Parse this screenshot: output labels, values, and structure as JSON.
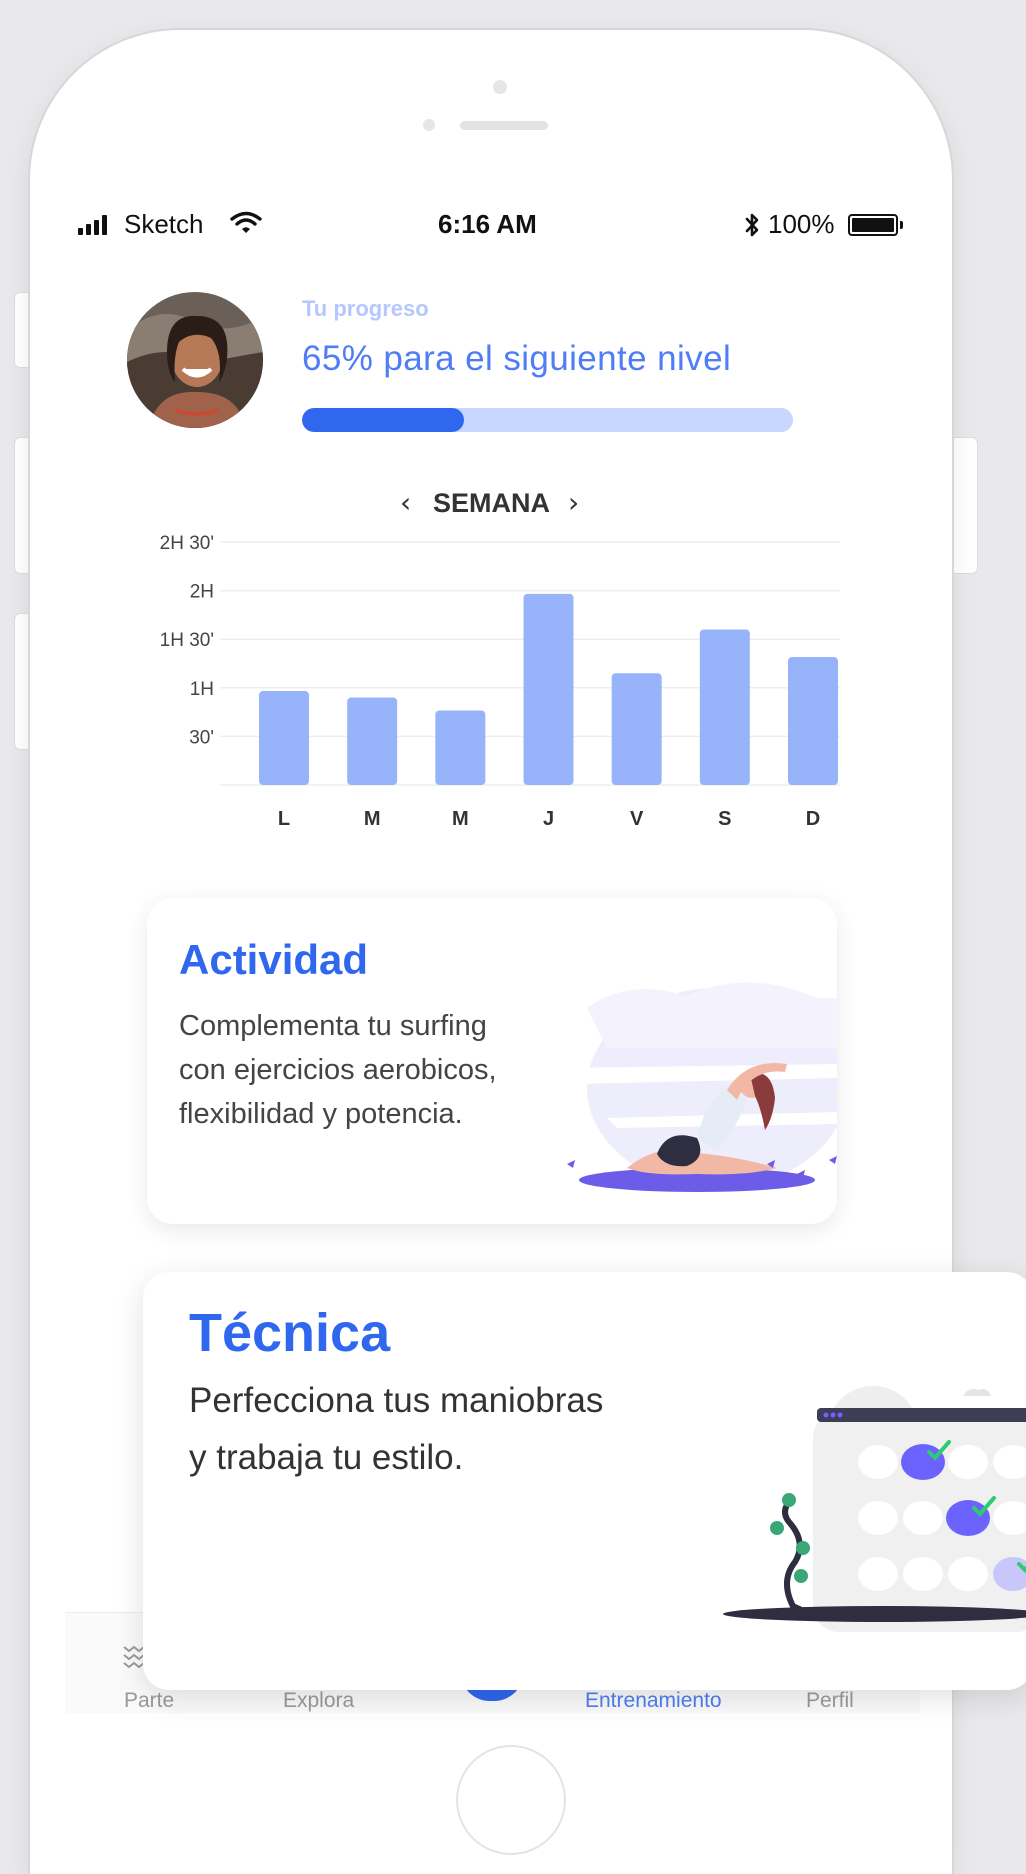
{
  "status_bar": {
    "carrier": "Sketch",
    "time": "6:16 AM",
    "battery_percent": "100%"
  },
  "progress": {
    "label": "Tu progreso",
    "title": "65% para el siguiente nivel",
    "fill_fraction": 0.33
  },
  "week_nav": {
    "prev": "‹",
    "label": "SEMANA",
    "next": "›"
  },
  "chart_data": {
    "type": "bar",
    "categories": [
      "L",
      "M",
      "M",
      "J",
      "V",
      "S",
      "D"
    ],
    "values": [
      58,
      54,
      46,
      118,
      69,
      96,
      79
    ],
    "y_ticks": [
      {
        "value": 150,
        "label": "2H 30'"
      },
      {
        "value": 120,
        "label": "2H"
      },
      {
        "value": 90,
        "label": "1H 30'"
      },
      {
        "value": 60,
        "label": "1H"
      },
      {
        "value": 30,
        "label": "30'"
      }
    ],
    "ylim": [
      0,
      150
    ],
    "grid": true,
    "colors": {
      "bar": "#97b4fb",
      "grid": "#eeeeee",
      "tick": "#444444"
    }
  },
  "cards": {
    "actividad": {
      "title": "Actividad",
      "description": "Complementa tu surfing con ejercicios aerobicos, flexibilidad y potencia."
    },
    "tecnica": {
      "title": "Técnica",
      "description": "Perfecciona tus maniobras y trabaja tu estilo."
    }
  },
  "bottom_nav": {
    "items": [
      {
        "label": "Parte",
        "icon": "wave-icon"
      },
      {
        "label": "Explora",
        "icon": "compass-icon"
      },
      {
        "label": "Entrenamiento",
        "icon": "training-icon",
        "active": true
      },
      {
        "label": "Perfil",
        "icon": "user-icon"
      }
    ]
  },
  "colors": {
    "accent": "#2f67ee",
    "accent_light": "#c8d7fe",
    "text_muted": "#b6c6ff",
    "nav_inactive": "#9a9a9a"
  }
}
